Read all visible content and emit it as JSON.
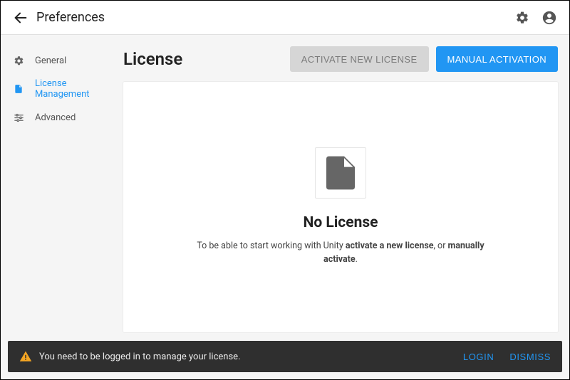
{
  "app_bar": {
    "title": "Preferences"
  },
  "sidebar": {
    "items": [
      {
        "label": "General"
      },
      {
        "label": "License Management"
      },
      {
        "label": "Advanced"
      }
    ]
  },
  "main": {
    "title": "License",
    "btn_activate": "Activate New License",
    "btn_manual": "Manual Activation",
    "empty": {
      "title": "No License",
      "desc_pre": "To be able to start working with Unity ",
      "desc_bold1": "activate a new license",
      "desc_mid": ", or ",
      "desc_bold2": "manually activate",
      "desc_post": "."
    }
  },
  "snackbar": {
    "message": "You need to be logged in to manage your license.",
    "login": "LOGIN",
    "dismiss": "DISMISS"
  }
}
